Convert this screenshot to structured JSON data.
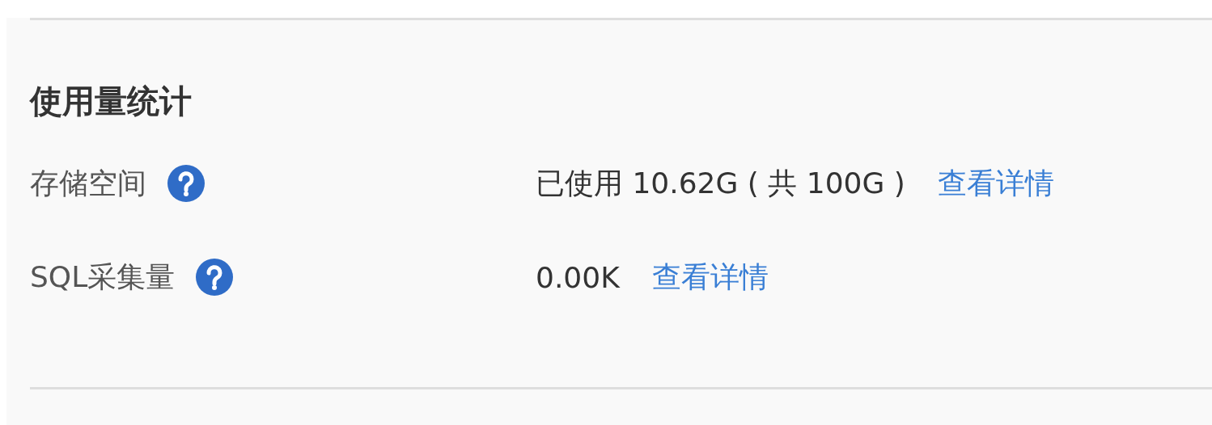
{
  "section": {
    "title": "使用量统计"
  },
  "rows": [
    {
      "label": "存储空间",
      "value": "已使用 10.62G ( 共 100G )",
      "link": "查看详情"
    },
    {
      "label": "SQL采集量",
      "value": "0.00K",
      "link": "查看详情"
    }
  ]
}
